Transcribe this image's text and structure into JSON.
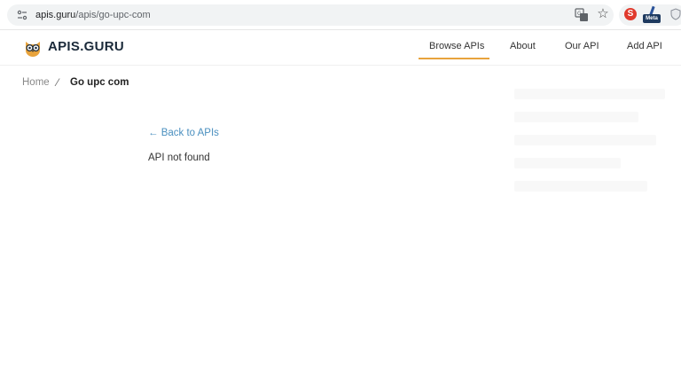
{
  "browser": {
    "url_host": "apis.guru",
    "url_path": "/apis/go-upc-com",
    "extensions": {
      "s_badge": "S",
      "meta_badge": "Meta"
    }
  },
  "site": {
    "logo_text": "APIS.GURU",
    "nav": {
      "browse": "Browse APIs",
      "about": "About",
      "our_api": "Our API",
      "add_api": "Add API"
    },
    "accent_color": "#e8a33c"
  },
  "breadcrumb": {
    "home": "Home",
    "separator": "⁄",
    "current": "Go upc com"
  },
  "main": {
    "back_link": "← Back to APIs",
    "message": "API not found"
  }
}
